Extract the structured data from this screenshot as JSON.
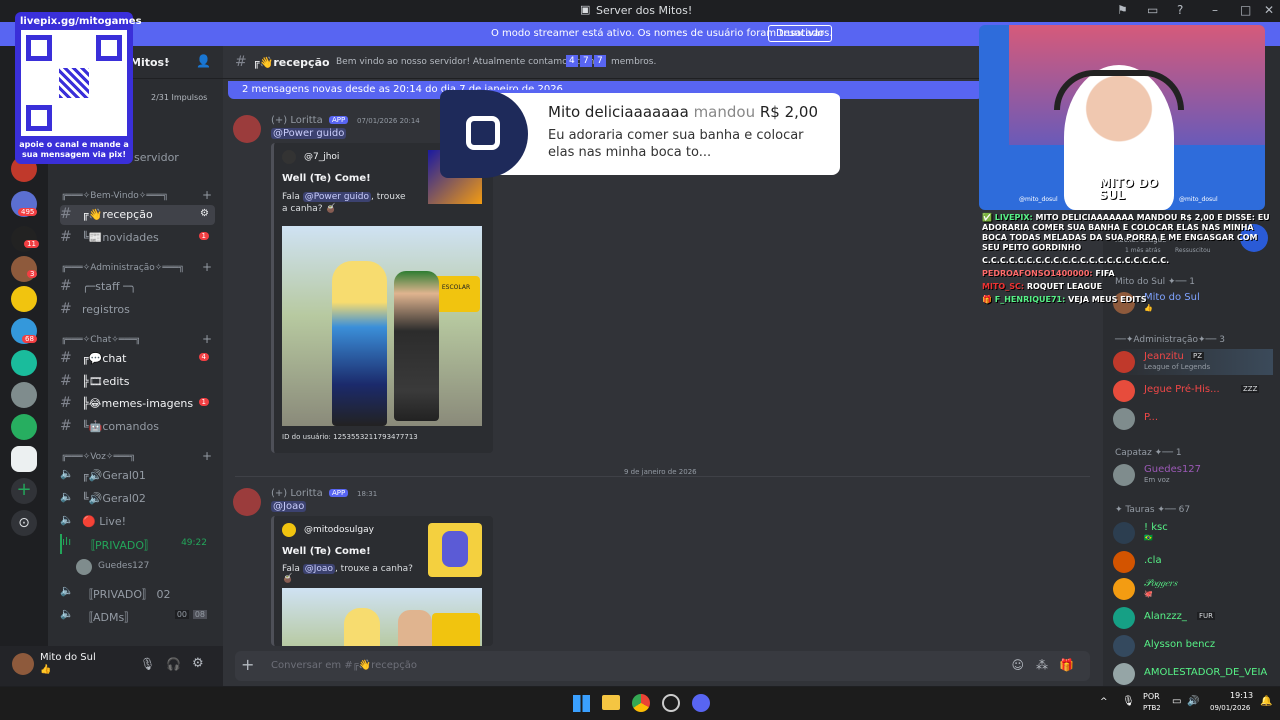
{
  "titlebar": {
    "title": "Server dos Mitos!"
  },
  "banner": {
    "text": "O modo streamer está ativo. Os nomes de usuário foram truncados.",
    "button": "Desativar"
  },
  "guilds": {
    "badges": [
      "495",
      "11",
      "3",
      "68"
    ]
  },
  "server": {
    "name": "Mitos!",
    "boosts": "2/31 Impulsos",
    "events_label": "servidor"
  },
  "channels": {
    "categories": [
      "╔═══✧Bem-Vindo✧═══╗",
      "╔═══✧Administração✧═══╗",
      "╔═══✧Chat✧═══╗",
      "╔═══✧Voz✧═══╗"
    ],
    "items": [
      {
        "label": "╔👋recepção",
        "badge": ""
      },
      {
        "label": "╚📰novidades",
        "badge": "1"
      },
      {
        "label": "╭─staff ─╮",
        "badge": ""
      },
      {
        "label": "registros",
        "badge": ""
      },
      {
        "label": "╔💬chat",
        "badge": "4"
      },
      {
        "label": "╠🎞edits",
        "badge": ""
      },
      {
        "label": "╠😂memes-imagens",
        "badge": "1"
      },
      {
        "label": "╚🤖comandos",
        "badge": ""
      }
    ],
    "voice": [
      {
        "label": "╔🔊Geral01"
      },
      {
        "label": "╚🔊Geral02"
      },
      {
        "label": "🔴 Live!"
      },
      {
        "label": "〚PRIVADO〛",
        "time": "49:22"
      },
      {
        "label": "〚PRIVADO〛 02"
      },
      {
        "label": "〚ADMs〛",
        "counts": [
          "00",
          "08"
        ]
      }
    ],
    "voice_user": "Guedes127"
  },
  "user": {
    "name": "Mito do Sul",
    "status": "👍"
  },
  "chat": {
    "channel": "╔👋recepção",
    "topic_pre": "Bem vindo ao nosso servidor! Atualmente contamos com",
    "member_digits": [
      "4",
      "7",
      "7"
    ],
    "topic_post": "membros.",
    "new_messages": "2 mensagens novas desde as 20:14 do dia 7 de janeiro de 2026",
    "messages": [
      {
        "author": "(+) Loritta",
        "tag": "APP",
        "time": "07/01/2026 20:14",
        "mention": "@Power guido",
        "embed_author": "@7_jhoi",
        "embed_title": "Well (Te) Come!",
        "embed_text_pre": "Fala",
        "embed_mention": "@Power guido",
        "embed_text_post": ", trouxe a canha? 🧉",
        "footer": "ID do usuário: 1253553211793477713",
        "image_sign": "ESCOLAR"
      },
      {
        "author": "(+) Loritta",
        "tag": "APP",
        "time": "18:31",
        "mention": "@Joao",
        "embed_author": "@mitodosulgay",
        "embed_title": "Well (Te) Come!",
        "embed_text_pre": "Fala",
        "embed_mention": "@Joao",
        "embed_text_post": ", trouxe a canha? 🧉"
      }
    ],
    "date_divider": "9 de janeiro de 2026",
    "composer_placeholder": "Conversar em #╔👋recepção"
  },
  "members": {
    "groups": [
      {
        "label": "Mito do Sul ✦── 1",
        "members": [
          {
            "name": "Mito do Sul",
            "sub": "👍",
            "color": "#7fa3ff"
          }
        ]
      },
      {
        "label": "──✦Administração✦── 3",
        "members": [
          {
            "name": "Jeanzitu",
            "tag": "PZ",
            "sub": "League of Legends",
            "color": "#f04747"
          },
          {
            "name": "Jegue Pré-His...",
            "tag": "ZZZ",
            "sub": "",
            "color": "#f04747"
          },
          {
            "name": "P...",
            "tag": "",
            "sub": "",
            "color": "#f04747"
          }
        ]
      },
      {
        "label": "Capataz ✦── 1",
        "members": [
          {
            "name": "Guedes127",
            "sub": "Em voz",
            "color": "#9b59b6"
          }
        ]
      },
      {
        "label": "✦ Tauras ✦── 67",
        "members": [
          {
            "name": "! ksc",
            "sub": "🇧🇷",
            "color": "#57f287"
          },
          {
            "name": ".cla",
            "sub": "",
            "color": "#57f287"
          },
          {
            "name": "𝒫𝑜𝑔𝑔𝑒𝑟𝑠",
            "sub": "🐙",
            "color": "#57f287"
          },
          {
            "name": "Alanzzz_",
            "tag": "FUR",
            "sub": "",
            "color": "#57f287"
          },
          {
            "name": "Alysson bencz",
            "sub": "",
            "color": "#57f287"
          },
          {
            "name": "AMOLESTADOR_DE_VEIA",
            "sub": "",
            "color": "#57f287"
          }
        ]
      }
    ]
  },
  "overlay": {
    "qr_top": "livepix.gg/mitogames",
    "qr_bottom": "apoie o canal e mande a sua mensagem via pix!",
    "donation_name": "Mito deliciaaaaaaa",
    "donation_verb": "mandou",
    "donation_amount": "R$ 2,00",
    "donation_msg": "Eu adoraria comer sua banha e colocar elas nas minha boca to...",
    "webcam_title": "MITO DO SUL",
    "webcam_handles": [
      "@mito_dosul",
      "@mito_dosul"
    ],
    "tv_label": "Rocket League",
    "tv_time": "1 mês atrás",
    "tv_status": "Ressuscitou",
    "chat": [
      {
        "user": "✅ LIVEPIX:",
        "text": "MITO DELICIAAAAAAA MANDOU R$ 2,00 E DISSE: EU ADORARIA COMER SUA BANHA E COLOCAR ELAS NAS MINHA BOCA TODAS MELADAS DA SUA PORRA E ME ENGASGAR COM SEU PEITO GORDINHO"
      },
      {
        "user": "",
        "text": "C.C.C.C.C.C.C.C.C.C.C.C.C.C.C.C.C.C.C.C.C."
      },
      {
        "user": "PEDROAFONSO1400000:",
        "text": "FIFA"
      },
      {
        "user": "MITO_SC:",
        "text": "ROQUET LEAGUE"
      },
      {
        "user": "🎁 F_HENRIQUE71:",
        "text": "VEJA MEUS EDITS"
      }
    ]
  },
  "taskbar": {
    "lang": "POR",
    "layout": "PTB2",
    "time": "19:13",
    "date": "09/01/2026"
  },
  "colors": {
    "accent": "#5865f2",
    "bg": "#313338",
    "sidebar": "#2b2d31",
    "danger": "#f23f43",
    "online": "#23a55a"
  }
}
